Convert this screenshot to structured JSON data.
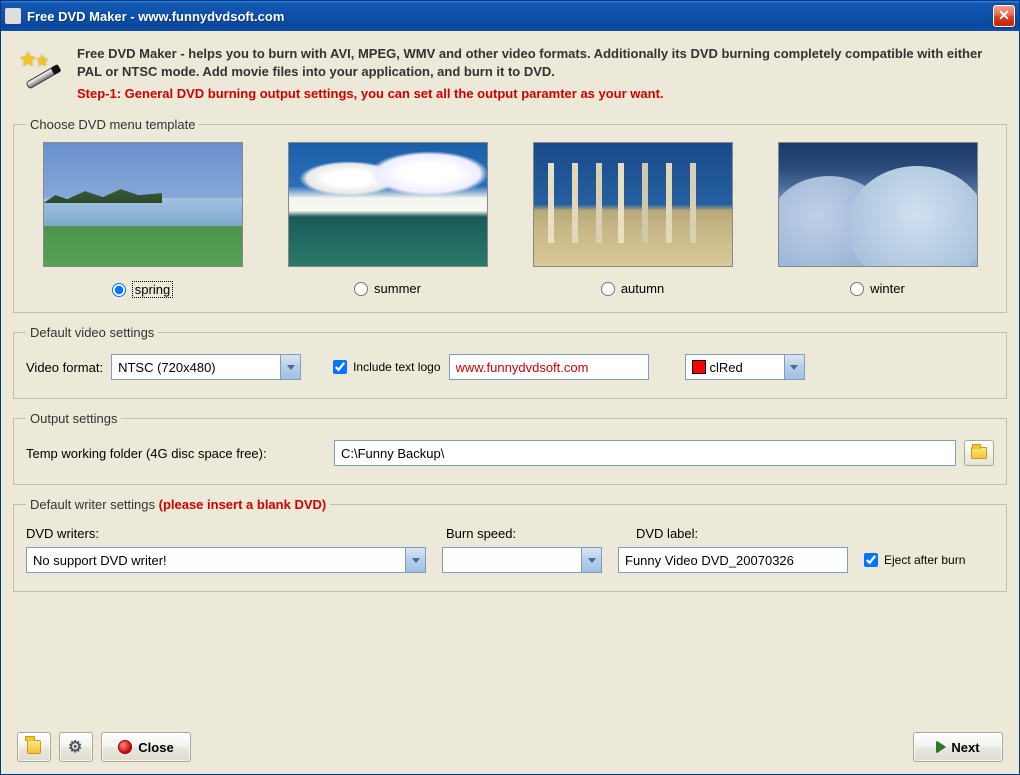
{
  "titlebar": {
    "title": "Free DVD Maker - www.funnydvdsoft.com"
  },
  "intro": {
    "line1": "Free DVD Maker - helps you to burn with AVI, MPEG, WMV and other video formats. Additionally its DVD burning completely compatible with either PAL or NTSC mode. Add movie files into your application, and burn it to DVD.",
    "step": "Step-1: General DVD burning output settings, you can set all the output paramter as your want."
  },
  "templates": {
    "legend": "Choose DVD menu template",
    "items": [
      {
        "label": "spring",
        "selected": true
      },
      {
        "label": "summer",
        "selected": false
      },
      {
        "label": "autumn",
        "selected": false
      },
      {
        "label": "winter",
        "selected": false
      }
    ]
  },
  "video": {
    "legend": "Default video settings",
    "format_label": "Video format:",
    "format_value": "NTSC (720x480)",
    "include_logo_label": "Include text logo",
    "include_logo_checked": true,
    "logo_text": "www.funnydvdsoft.com",
    "color_value": "clRed"
  },
  "output": {
    "legend": "Output settings",
    "temp_label": "Temp working folder (4G disc space free):",
    "temp_value": "C:\\Funny Backup\\"
  },
  "writer": {
    "legend_main": "Default writer settings",
    "legend_note": "  (please insert a blank DVD)",
    "writers_label": "DVD writers:",
    "writers_value": "No support DVD writer!",
    "speed_label": "Burn speed:",
    "speed_value": "",
    "dvdlabel_label": "DVD label:",
    "dvdlabel_value": "Funny Video DVD_20070326",
    "eject_label": "Eject after burn",
    "eject_checked": true
  },
  "buttons": {
    "close": "Close",
    "next": "Next"
  }
}
